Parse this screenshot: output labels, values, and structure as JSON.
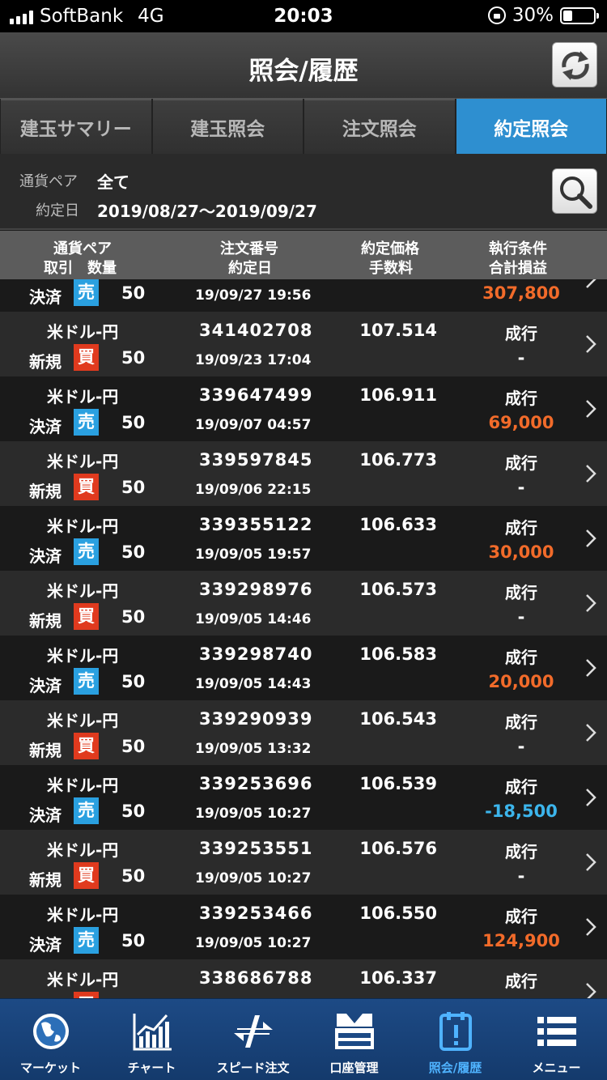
{
  "status_bar": {
    "carrier": "SoftBank",
    "network": "4G",
    "time": "20:03",
    "battery": "30%",
    "battery_level": 0.3
  },
  "header": {
    "title": "照会/履歴"
  },
  "tabs": [
    {
      "label": "建玉サマリー",
      "active": false
    },
    {
      "label": "建玉照会",
      "active": false
    },
    {
      "label": "注文照会",
      "active": false
    },
    {
      "label": "約定照会",
      "active": true
    }
  ],
  "filter": {
    "pair_label": "通貨ペア",
    "pair_value": "全て",
    "date_label": "約定日",
    "date_value": "2019/08/27〜2019/09/27"
  },
  "columns": {
    "c1_line1": "通貨ペア",
    "c1_line2": "取引　数量",
    "c2_line1": "注文番号",
    "c2_line2": "約定日",
    "c3_line1": "約定価格",
    "c3_line2": "手数料",
    "c4_line1": "執行条件",
    "c4_line2": "合計損益"
  },
  "rows": [
    {
      "pair": "",
      "kind": "決済",
      "side": "売",
      "qty": "50",
      "order": "",
      "date": "19/09/27 19:56",
      "price": "",
      "cond": "",
      "pnl": "307,800",
      "pnl_type": "pos"
    },
    {
      "pair": "米ドル-円",
      "kind": "新規",
      "side": "買",
      "qty": "50",
      "order": "341402708",
      "date": "19/09/23 17:04",
      "price": "107.514",
      "cond": "成行",
      "pnl": "-",
      "pnl_type": "none"
    },
    {
      "pair": "米ドル-円",
      "kind": "決済",
      "side": "売",
      "qty": "50",
      "order": "339647499",
      "date": "19/09/07 04:57",
      "price": "106.911",
      "cond": "成行",
      "pnl": "69,000",
      "pnl_type": "pos"
    },
    {
      "pair": "米ドル-円",
      "kind": "新規",
      "side": "買",
      "qty": "50",
      "order": "339597845",
      "date": "19/09/06 22:15",
      "price": "106.773",
      "cond": "成行",
      "pnl": "-",
      "pnl_type": "none"
    },
    {
      "pair": "米ドル-円",
      "kind": "決済",
      "side": "売",
      "qty": "50",
      "order": "339355122",
      "date": "19/09/05 19:57",
      "price": "106.633",
      "cond": "成行",
      "pnl": "30,000",
      "pnl_type": "pos"
    },
    {
      "pair": "米ドル-円",
      "kind": "新規",
      "side": "買",
      "qty": "50",
      "order": "339298976",
      "date": "19/09/05 14:46",
      "price": "106.573",
      "cond": "成行",
      "pnl": "-",
      "pnl_type": "none"
    },
    {
      "pair": "米ドル-円",
      "kind": "決済",
      "side": "売",
      "qty": "50",
      "order": "339298740",
      "date": "19/09/05 14:43",
      "price": "106.583",
      "cond": "成行",
      "pnl": "20,000",
      "pnl_type": "pos"
    },
    {
      "pair": "米ドル-円",
      "kind": "新規",
      "side": "買",
      "qty": "50",
      "order": "339290939",
      "date": "19/09/05 13:32",
      "price": "106.543",
      "cond": "成行",
      "pnl": "-",
      "pnl_type": "none"
    },
    {
      "pair": "米ドル-円",
      "kind": "決済",
      "side": "売",
      "qty": "50",
      "order": "339253696",
      "date": "19/09/05 10:27",
      "price": "106.539",
      "cond": "成行",
      "pnl": "-18,500",
      "pnl_type": "neg"
    },
    {
      "pair": "米ドル-円",
      "kind": "新規",
      "side": "買",
      "qty": "50",
      "order": "339253551",
      "date": "19/09/05 10:27",
      "price": "106.576",
      "cond": "成行",
      "pnl": "-",
      "pnl_type": "none"
    },
    {
      "pair": "米ドル-円",
      "kind": "決済",
      "side": "売",
      "qty": "50",
      "order": "339253466",
      "date": "19/09/05 10:27",
      "price": "106.550",
      "cond": "成行",
      "pnl": "124,900",
      "pnl_type": "pos"
    },
    {
      "pair": "米ドル-円",
      "kind": "",
      "side": "買",
      "qty": "",
      "order": "338686788",
      "date": "",
      "price": "106.337",
      "cond": "成行",
      "pnl": "",
      "pnl_type": "none"
    }
  ],
  "tabbar": [
    {
      "label": "マーケット",
      "icon": "globe-icon",
      "active": false
    },
    {
      "label": "チャート",
      "icon": "chart-icon",
      "active": false
    },
    {
      "label": "スピード注文",
      "icon": "speed-order-icon",
      "active": false
    },
    {
      "label": "口座管理",
      "icon": "account-icon",
      "active": false
    },
    {
      "label": "照会/履歴",
      "icon": "history-icon",
      "active": true
    },
    {
      "label": "メニュー",
      "icon": "menu-icon",
      "active": false
    }
  ],
  "colors": {
    "accent": "#2e8fd0",
    "profit": "#f26b2a",
    "loss": "#3cb5ec",
    "sell": "#2aa0e0",
    "buy": "#e03a1e",
    "tabbar": "#1d4a85"
  }
}
